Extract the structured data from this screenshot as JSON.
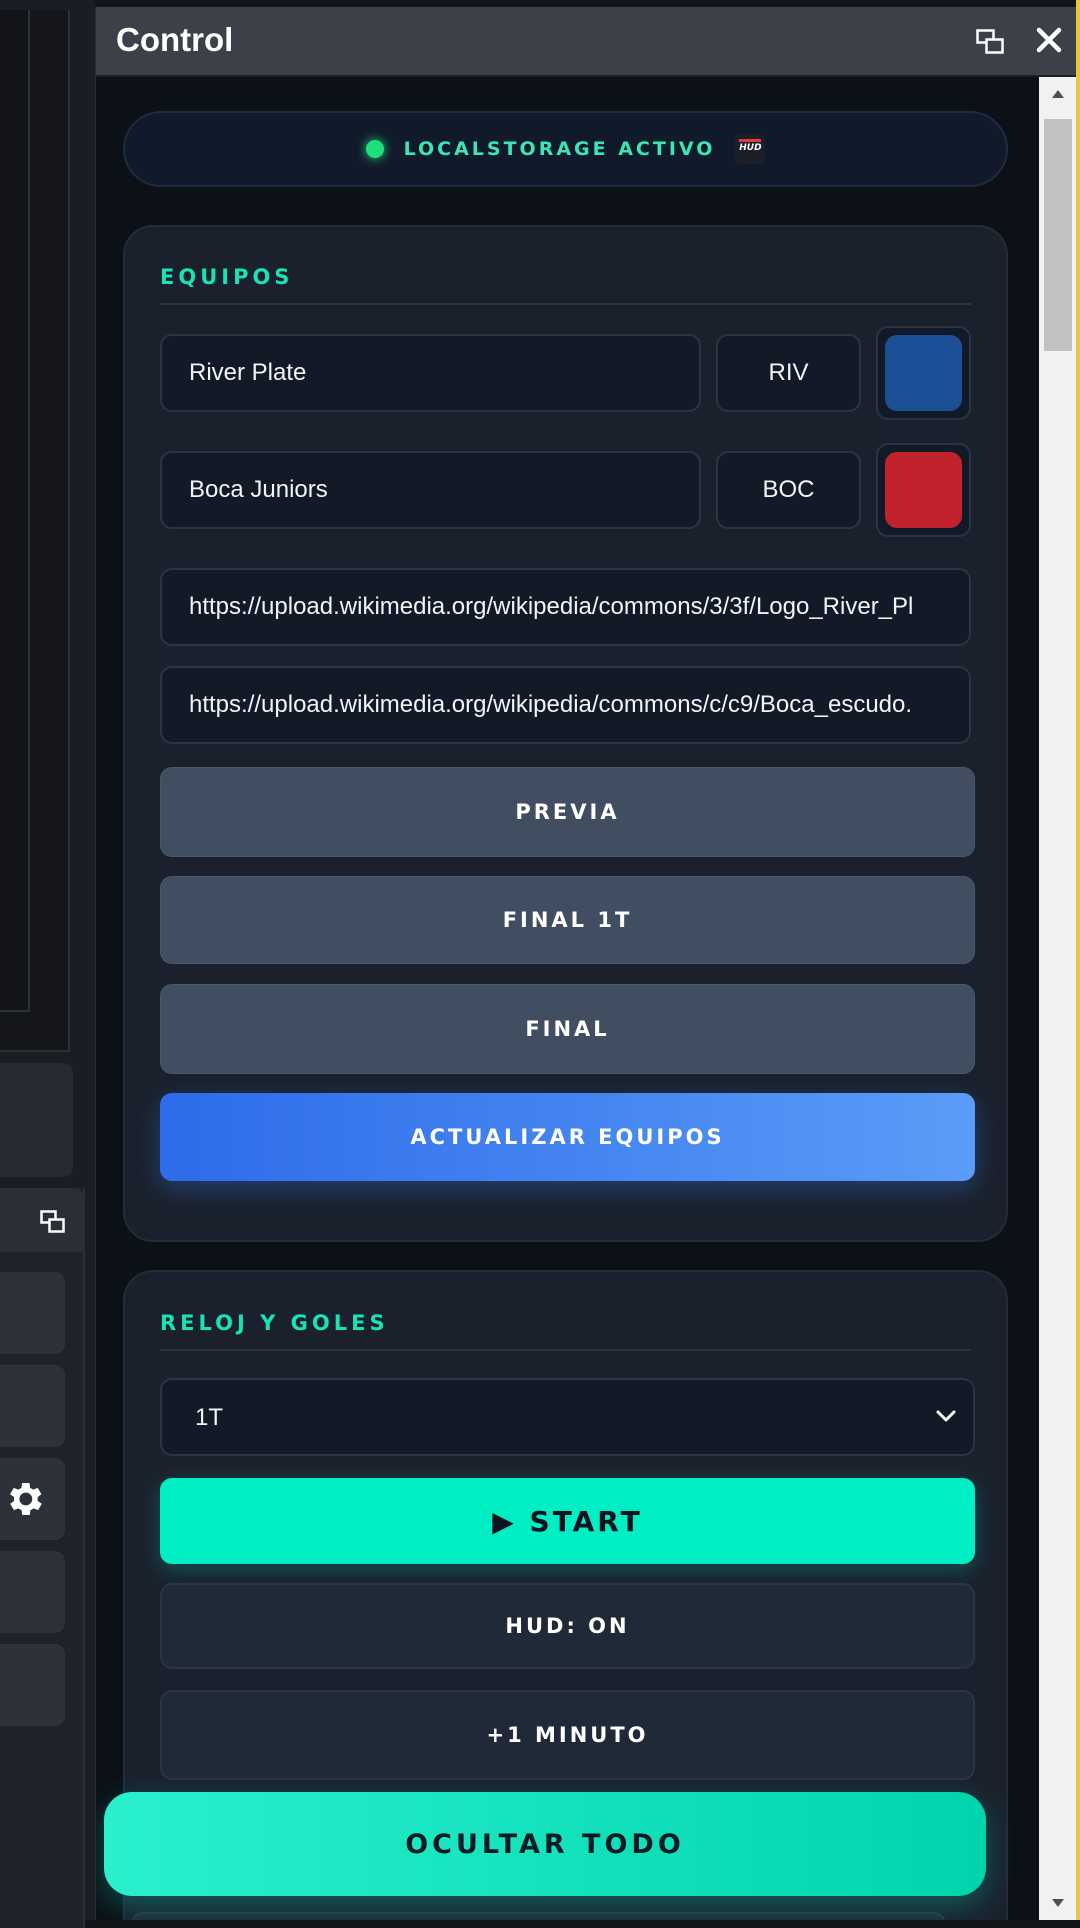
{
  "window": {
    "title": "Control"
  },
  "status": {
    "label": "LOCALSTORAGE ACTIVO",
    "logo_text": "HUD",
    "dot_color": "#1ee07a"
  },
  "equipos": {
    "title": "EQUIPOS",
    "team1": {
      "name": "River Plate",
      "abbr": "RIV",
      "color": "#1d4f96"
    },
    "team2": {
      "name": "Boca Juniors",
      "abbr": "BOC",
      "color": "#c1222c"
    },
    "logo1_url": "https://upload.wikimedia.org/wikipedia/commons/3/3f/Logo_River_Pl",
    "logo2_url": "https://upload.wikimedia.org/wikipedia/commons/c/c9/Boca_escudo.",
    "buttons": {
      "previa": "PREVIA",
      "final_1t": "FINAL 1T",
      "final": "FINAL",
      "actualizar": "ACTUALIZAR EQUIPOS"
    }
  },
  "reloj": {
    "title": "RELOJ Y GOLES",
    "period_selected": "1T",
    "start": "▶  START",
    "hud": "HUD: ON",
    "plus_minute": "+1 MINUTO"
  },
  "floating": {
    "ocultar": "OCULTAR TODO"
  },
  "icons": {
    "popout": "popout-icon",
    "close": "close-icon",
    "gear": "gear-icon",
    "chevron": "chevron-down-icon"
  }
}
